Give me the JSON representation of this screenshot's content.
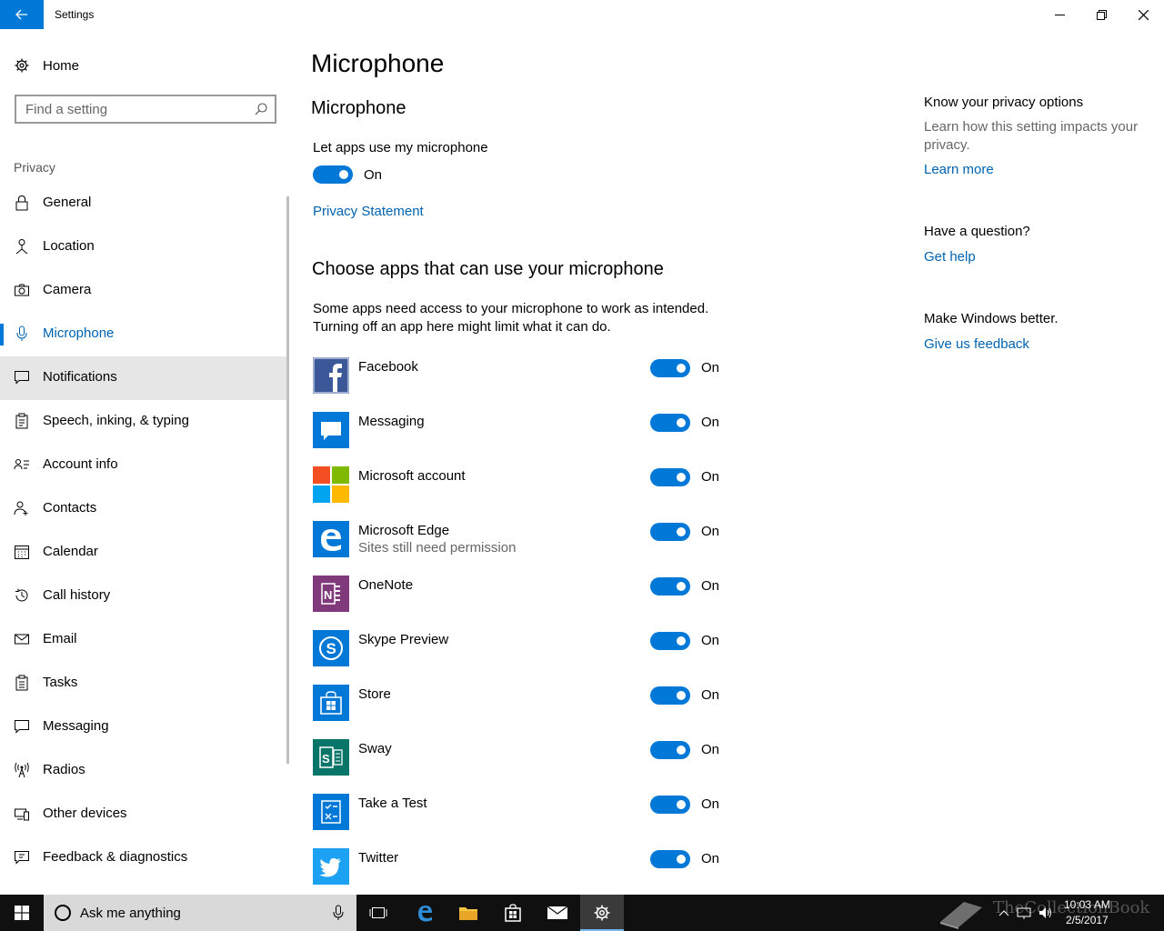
{
  "window": {
    "title": "Settings",
    "minimize_icon": "minimize-icon",
    "maximize_icon": "restore-icon",
    "close_icon": "close-icon"
  },
  "sidebar": {
    "home_label": "Home",
    "search_placeholder": "Find a setting",
    "section_label": "Privacy",
    "items": [
      {
        "label": "General",
        "icon": "lock-icon"
      },
      {
        "label": "Location",
        "icon": "location-icon"
      },
      {
        "label": "Camera",
        "icon": "camera-icon"
      },
      {
        "label": "Microphone",
        "icon": "microphone-icon",
        "active": true
      },
      {
        "label": "Notifications",
        "icon": "notification-icon",
        "hover": true
      },
      {
        "label": "Speech, inking, & typing",
        "icon": "speech-icon"
      },
      {
        "label": "Account info",
        "icon": "account-icon"
      },
      {
        "label": "Contacts",
        "icon": "contacts-icon"
      },
      {
        "label": "Calendar",
        "icon": "calendar-icon"
      },
      {
        "label": "Call history",
        "icon": "history-icon"
      },
      {
        "label": "Email",
        "icon": "email-icon"
      },
      {
        "label": "Tasks",
        "icon": "tasks-icon"
      },
      {
        "label": "Messaging",
        "icon": "messaging-icon"
      },
      {
        "label": "Radios",
        "icon": "radios-icon"
      },
      {
        "label": "Other devices",
        "icon": "devices-icon"
      },
      {
        "label": "Feedback & diagnostics",
        "icon": "feedback-icon"
      }
    ]
  },
  "main": {
    "page_title": "Microphone",
    "sub_title": "Microphone",
    "let_apps_label": "Let apps use my microphone",
    "master_toggle_state": "On",
    "privacy_link": "Privacy Statement",
    "choose_title": "Choose apps that can use your microphone",
    "choose_desc": "Some apps need access to your microphone to work as intended. Turning off an app here might limit what it can do.",
    "apps": [
      {
        "name": "Facebook",
        "state": "On",
        "color": "#3b5998",
        "icon": "facebook-icon"
      },
      {
        "name": "Messaging",
        "state": "On",
        "color": "#0078d7",
        "icon": "messaging-app-icon"
      },
      {
        "name": "Microsoft account",
        "state": "On",
        "color": "#ffffff",
        "icon": "microsoft-logo-icon"
      },
      {
        "name": "Microsoft Edge",
        "sub": "Sites still need permission",
        "state": "On",
        "color": "#0078d7",
        "icon": "edge-icon"
      },
      {
        "name": "OneNote",
        "state": "On",
        "color": "#80397b",
        "icon": "onenote-icon"
      },
      {
        "name": "Skype Preview",
        "state": "On",
        "color": "#0078d7",
        "icon": "skype-icon"
      },
      {
        "name": "Store",
        "state": "On",
        "color": "#0078d7",
        "icon": "store-icon"
      },
      {
        "name": "Sway",
        "state": "On",
        "color": "#077568",
        "icon": "sway-icon"
      },
      {
        "name": "Take a Test",
        "state": "On",
        "color": "#0078d7",
        "icon": "take-a-test-icon"
      },
      {
        "name": "Twitter",
        "state": "On",
        "color": "#1da1f2",
        "icon": "twitter-icon"
      }
    ]
  },
  "aside": {
    "privacy_heading": "Know your privacy options",
    "privacy_text": "Learn how this setting impacts your privacy.",
    "learn_more": "Learn more",
    "question_heading": "Have a question?",
    "get_help": "Get help",
    "better_heading": "Make Windows better.",
    "feedback_link": "Give us feedback"
  },
  "taskbar": {
    "search_text": "Ask me anything",
    "time": "10:03 AM",
    "date": "2/5/2017",
    "watermark": "TheCollectionBook"
  },
  "colors": {
    "accent": "#0078d7",
    "link": "#0063b1",
    "taskbar": "#101010"
  }
}
